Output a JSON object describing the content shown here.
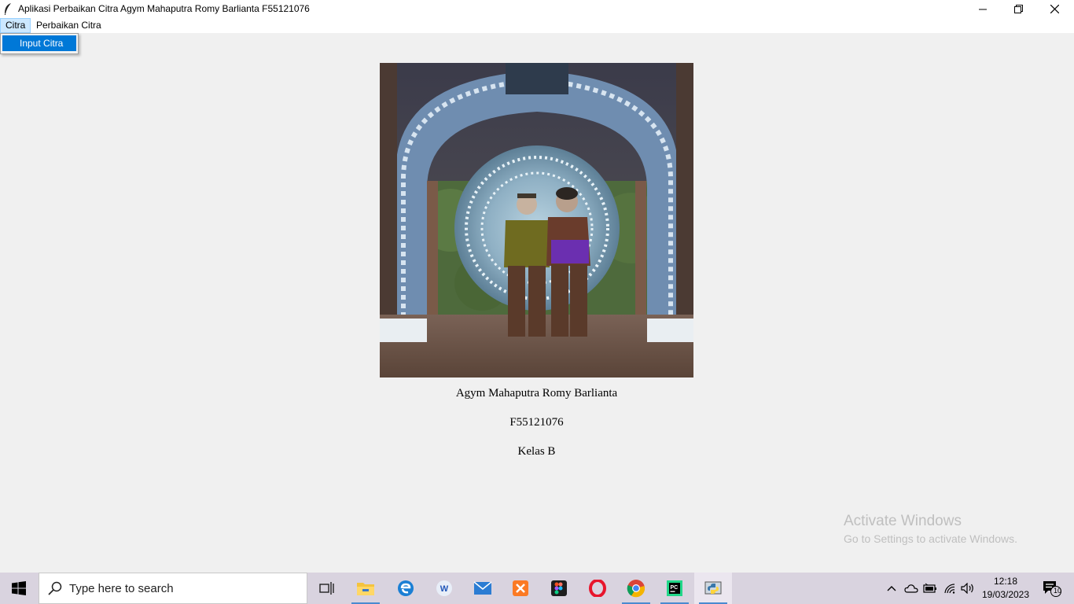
{
  "window": {
    "title": "Aplikasi Perbaikan Citra Agym Mahaputra Romy Barlianta F55121076",
    "controls": [
      "minimize-icon",
      "restore-icon",
      "close-icon"
    ]
  },
  "menubar": {
    "items": [
      {
        "label": "Citra",
        "active": true
      },
      {
        "label": "Perbaikan Citra",
        "active": false
      }
    ]
  },
  "dropdown": {
    "items": [
      {
        "label": "Input Citra",
        "highlighted": true
      }
    ]
  },
  "main": {
    "photo_description": "photo of two people under a decorated arch with a large gong",
    "name": "Agym Mahaputra Romy Barlianta",
    "nim": "F55121076",
    "class": "Kelas B"
  },
  "watermark": {
    "line1": "Activate Windows",
    "line2": "Go to Settings to activate Windows."
  },
  "taskbar": {
    "search_placeholder": "Type here to search",
    "apps": [
      "task-view-icon",
      "file-explorer-icon",
      "edge-icon",
      "wps-icon",
      "mail-icon",
      "xampp-icon",
      "figma-icon",
      "opera-icon",
      "chrome-icon",
      "pycharm-icon",
      "python-tkinter-icon"
    ],
    "tray_icons": [
      "chevron-up-icon",
      "onedrive-icon",
      "battery-icon",
      "wifi-icon",
      "volume-icon"
    ],
    "time": "12:18",
    "date": "19/03/2023",
    "notification_count": "10"
  },
  "colors": {
    "accent": "#0078d7",
    "menu_active": "#cce8ff",
    "background": "#f0f0f0",
    "taskbar": "#d9d3df"
  }
}
